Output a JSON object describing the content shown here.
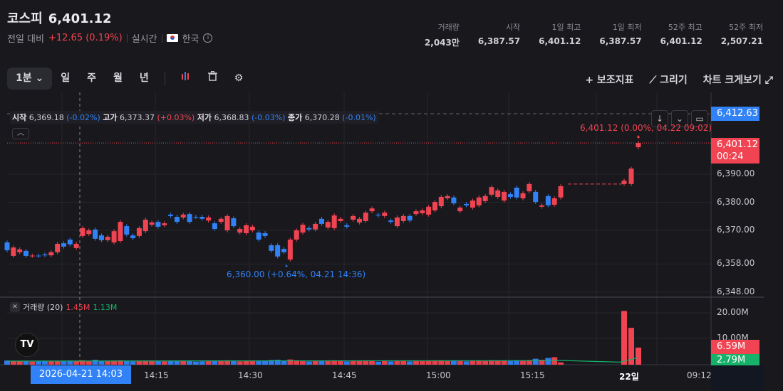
{
  "header": {
    "name": "코스피",
    "price": "6,401.12",
    "change_label": "전일 대비",
    "change": "+12.65 (0.19%)",
    "realtime": "실시간",
    "market": "한국",
    "info_icon": "info-icon"
  },
  "stats": [
    {
      "label": "거래량",
      "value": "2,043만"
    },
    {
      "label": "시작",
      "value": "6,387.57"
    },
    {
      "label": "1일 최고",
      "value": "6,401.12"
    },
    {
      "label": "1일 최저",
      "value": "6,387.57"
    },
    {
      "label": "52주 최고",
      "value": "6,401.12"
    },
    {
      "label": "52주 최저",
      "value": "2,507.21"
    }
  ],
  "toolbar": {
    "interval": "1분",
    "periods": [
      "일",
      "주",
      "월",
      "년"
    ],
    "indicators": "+ 보조지표",
    "draw": "⟋ 그리기",
    "fullscreen": "차트 크게보기 ⤢"
  },
  "legend": {
    "open_l": "시작",
    "open": "6,369.18",
    "open_p": "(-0.02%)",
    "high_l": "고가",
    "high": "6,373.37",
    "high_p": "(+0.03%)",
    "low_l": "저가",
    "low": "6,368.83",
    "low_p": "(-0.03%)",
    "close_l": "종가",
    "close": "6,370.28",
    "close_p": "(-0.01%)"
  },
  "annotations": {
    "high": "6,401.12 (0.00%, 04.22 09:02)",
    "low": "6,360.00 (+0.64%, 04.21 14:36)"
  },
  "price_axis": {
    "ticks": [
      6390,
      6380,
      6370,
      6358,
      6348
    ],
    "tick_labels": [
      "6,390.00",
      "6,380.00",
      "6,370.00",
      "6,358.00",
      "6,348.00"
    ],
    "top_tag": "6,412.63",
    "last_price": "6,401.12",
    "countdown": "00:24"
  },
  "volume_panel": {
    "label": "거래량 (20)",
    "vol": "1.45M",
    "ma": "1.13M",
    "ticks": [
      "20.00M",
      "10.00M"
    ],
    "tag_vol": "6.59M",
    "tag_ma": "2.79M"
  },
  "time_axis": {
    "labels": [
      "14:15",
      "14:30",
      "14:45",
      "15:00",
      "15:15",
      "22일",
      "09:12"
    ],
    "crosshair": "2026-04-21   14:03"
  },
  "colors": {
    "up": "#f04452",
    "down": "#3182f6",
    "ma": "#17b26a",
    "bg": "#18181d"
  },
  "chart_data": {
    "type": "candlestick",
    "y_range": [
      6345,
      6415
    ],
    "candles": [
      [
        6365.7,
        6362.9
      ],
      [
        6360.9,
        6363.9
      ],
      [
        6362.2,
        6363.2
      ],
      [
        6362.7,
        6360.9
      ],
      [
        6360.9,
        6361.0
      ],
      [
        6361.0,
        6360.9
      ],
      [
        6361.4,
        6361.1
      ],
      [
        6361.1,
        6362.2
      ],
      [
        6362.2,
        6365.2
      ],
      [
        6365.4,
        6364.2
      ],
      [
        6366.7,
        6365.0
      ],
      [
        6363.7,
        6365.2
      ],
      [
        6368.0,
        6370.8
      ],
      [
        6368.7,
        6370.0
      ],
      [
        6370.3,
        6367.0
      ],
      [
        6368.2,
        6366.5
      ],
      [
        6366.5,
        6367.7
      ],
      [
        6365.7,
        6369.7
      ],
      [
        6366.2,
        6373.0
      ],
      [
        6371.5,
        6368.5
      ],
      [
        6368.2,
        6367.2
      ],
      [
        6368.0,
        6370.8
      ],
      [
        6369.7,
        6373.8
      ],
      [
        6372.0,
        6372.8
      ],
      [
        6373.0,
        6371.3
      ],
      [
        6371.8,
        6372.5
      ],
      [
        6375.6,
        6375.1
      ],
      [
        6374.8,
        6373.0
      ],
      [
        6374.6,
        6375.6
      ],
      [
        6375.8,
        6373.0
      ],
      [
        6374.8,
        6374.7
      ],
      [
        6374.8,
        6374.1
      ],
      [
        6373.5,
        6374.6
      ],
      [
        6372.5,
        6370.5
      ],
      [
        6373.0,
        6374.1
      ],
      [
        6370.0,
        6375.1
      ],
      [
        6374.3,
        6371.5
      ],
      [
        6369.2,
        6370.5
      ],
      [
        6369.0,
        6371.8
      ],
      [
        6370.0,
        6371.3
      ],
      [
        6369.2,
        6366.7
      ],
      [
        6369.0,
        6368.0
      ],
      [
        6364.7,
        6362.7
      ],
      [
        6364.7,
        6360.7
      ],
      [
        6363.4,
        6362.2
      ],
      [
        6359.6,
        6366.7
      ],
      [
        6366.7,
        6370.0
      ],
      [
        6369.2,
        6372.0
      ],
      [
        6370.8,
        6370.3
      ],
      [
        6370.3,
        6372.3
      ],
      [
        6374.1,
        6372.3
      ],
      [
        6371.0,
        6373.0
      ],
      [
        6370.8,
        6375.3
      ],
      [
        6373.3,
        6374.1
      ],
      [
        6371.8,
        6371.3
      ],
      [
        6373.8,
        6375.1
      ],
      [
        6372.8,
        6374.1
      ],
      [
        6373.3,
        6376.3
      ],
      [
        6376.8,
        6377.8
      ],
      [
        6375.6,
        6375.3
      ],
      [
        6375.1,
        6376.3
      ],
      [
        6373.5,
        6373.0
      ],
      [
        6371.5,
        6374.6
      ],
      [
        6373.3,
        6375.1
      ],
      [
        6375.1,
        6373.5
      ],
      [
        6375.8,
        6376.8
      ],
      [
        6376.1,
        6377.1
      ],
      [
        6375.6,
        6378.4
      ],
      [
        6377.1,
        6380.1
      ],
      [
        6378.6,
        6381.9
      ],
      [
        6381.4,
        6382.2
      ],
      [
        6381.7,
        6379.6
      ],
      [
        6376.8,
        6378.1
      ],
      [
        6379.4,
        6378.9
      ],
      [
        6378.1,
        6380.6
      ],
      [
        6378.9,
        6381.7
      ],
      [
        6380.4,
        6382.2
      ],
      [
        6382.7,
        6385.4
      ],
      [
        6381.9,
        6384.2
      ],
      [
        6380.6,
        6383.7
      ],
      [
        6382.9,
        6381.9
      ],
      [
        6385.2,
        6381.7
      ],
      [
        6381.4,
        6383.2
      ],
      [
        6383.9,
        6386.5
      ],
      [
        6383.7,
        6380.1
      ],
      [
        6378.4,
        6378.9
      ],
      [
        6382.2,
        6378.9
      ],
      [
        6379.1,
        6381.4
      ],
      [
        6381.7,
        6385.7
      ]
    ],
    "gap_level": 6386.5,
    "next_session": [
      [
        6386.5,
        6387.7
      ],
      [
        6386.5,
        6392.0
      ],
      [
        6399.6,
        6401.12
      ]
    ],
    "vol_range": [
      0,
      22
    ],
    "volumes": [
      1.6,
      1.4,
      1.3,
      1.5,
      1.2,
      1.3,
      1.4,
      1.3,
      1.5,
      1.4,
      1.6,
      1.4,
      1.7,
      1.5,
      1.9,
      1.4,
      1.5,
      1.6,
      1.7,
      1.5,
      1.3,
      1.5,
      1.6,
      1.4,
      1.5,
      1.3,
      1.4,
      1.6,
      1.4,
      1.5,
      1.2,
      1.3,
      1.4,
      1.6,
      1.4,
      1.7,
      1.5,
      1.3,
      1.5,
      1.4,
      1.6,
      1.4,
      1.8,
      1.9,
      1.5,
      2.0,
      1.7,
      1.5,
      1.3,
      1.5,
      1.4,
      1.4,
      1.7,
      1.4,
      1.3,
      1.5,
      1.4,
      1.6,
      1.5,
      1.2,
      1.4,
      1.3,
      1.5,
      1.4,
      1.3,
      1.4,
      1.4,
      1.5,
      1.6,
      1.7,
      1.4,
      1.5,
      1.4,
      1.3,
      1.5,
      1.6,
      1.4,
      1.7,
      1.5,
      1.6,
      1.4,
      1.7,
      1.5,
      1.8,
      2.3,
      1.9,
      2.6,
      2.9,
      0.9
    ],
    "next_volumes": [
      20.7,
      14.2,
      6.59
    ],
    "ma_start": 1.4,
    "ma_end": 2.79
  }
}
